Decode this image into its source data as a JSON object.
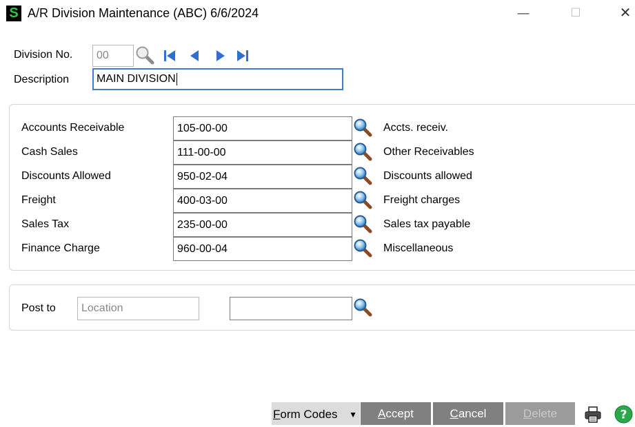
{
  "window": {
    "app_icon_letter": "S",
    "title": "A/R Division Maintenance (ABC) 6/6/2024",
    "minimize": "—",
    "maximize": "☐",
    "close": "✕"
  },
  "header": {
    "division_label": "Division No.",
    "division_value": "00",
    "description_label": "Description",
    "description_value": "MAIN DIVISION"
  },
  "accounts": [
    {
      "label": "Accounts Receivable",
      "value": "105-00-00",
      "description": "Accts. receiv."
    },
    {
      "label": "Cash Sales",
      "value": "111-00-00",
      "description": "Other Receivables"
    },
    {
      "label": "Discounts Allowed",
      "value": "950-02-04",
      "description": "Discounts allowed"
    },
    {
      "label": "Freight",
      "value": "400-03-00",
      "description": "Freight charges"
    },
    {
      "label": "Sales Tax",
      "value": "235-00-00",
      "description": "Sales tax payable"
    },
    {
      "label": "Finance Charge",
      "value": "960-00-04",
      "description": "Miscellaneous"
    }
  ],
  "post": {
    "label": "Post to",
    "location_placeholder": "Location",
    "value": ""
  },
  "buttons": {
    "form_codes_u": "F",
    "form_codes_rest": "orm Codes",
    "form_codes_arrow": "▼",
    "accept_u": "A",
    "accept_rest": "ccept",
    "cancel_u": "C",
    "cancel_rest": "ancel",
    "delete_u": "D",
    "delete_rest": "elete"
  },
  "colors": {
    "accent_focus": "#3c7fd1",
    "button_gray": "#808080",
    "help_green": "#2aa84a",
    "app_icon_green": "#2ec93a"
  },
  "icons": {
    "lookup": "magnifier-icon",
    "first": "first-record-icon",
    "prev": "previous-record-icon",
    "next": "next-record-icon",
    "last": "last-record-icon",
    "print": "printer-icon",
    "help": "help-icon"
  }
}
